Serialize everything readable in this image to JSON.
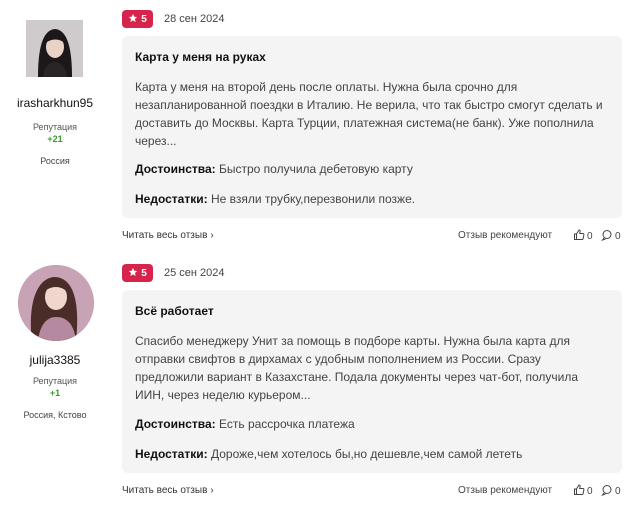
{
  "reviews": [
    {
      "author": {
        "name": "irasharkhun95",
        "reputation_label": "Репутация",
        "reputation_value": "+21",
        "location": "Россия"
      },
      "rating": "5",
      "date": "28 сен 2024",
      "title": "Карта у меня на руках",
      "text": "Карта у меня на второй день после оплаты. Нужна была срочно для незапланированной поездки в Италию. Не верила, что так быстро смогут сделать и доставить до Москвы. Карта Турции, платежная система(не банк). Уже пополнила через...",
      "pros_label": "Достоинства:",
      "pros": "Быстро получила дебетовую карту",
      "cons_label": "Недостатки:",
      "cons": "Не взяли трубку,перезвонили позже.",
      "read_more": "Читать весь отзыв",
      "recommend": "Отзыв рекомендуют",
      "likes": "0",
      "comments": "0"
    },
    {
      "author": {
        "name": "julija3385",
        "reputation_label": "Репутация",
        "reputation_value": "+1",
        "location": "Россия, Кстово"
      },
      "rating": "5",
      "date": "25 сен 2024",
      "title": "Всё работает",
      "text": "Спасибо менеджеру Унит за помощь в подборе карты. Нужна была карта для отправки свифтов в дирхамах с удобным пополнением из России. Сразу предложили вариант в Казахстане. Подала документы через чат-бот, получила ИИН, через неделю курьером...",
      "pros_label": "Достоинства:",
      "pros": "Есть рассрочка платежа",
      "cons_label": "Недостатки:",
      "cons": "Дороже,чем хотелось бы,но дешевле,чем самой лететь",
      "read_more": "Читать весь отзыв",
      "recommend": "Отзыв рекомендуют",
      "likes": "0",
      "comments": "0"
    }
  ],
  "colors": {
    "badge": "#d6244c",
    "card_bg": "#f4f4f5",
    "reputation": "#3a9a2a"
  },
  "icons": {
    "star": "star-icon",
    "thumb": "thumb-up-icon",
    "comment": "comment-icon",
    "chevron": "chevron-right-icon"
  }
}
